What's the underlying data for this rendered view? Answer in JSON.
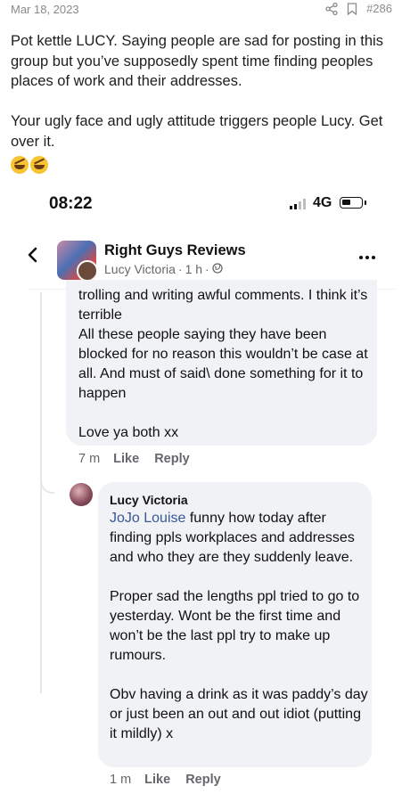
{
  "post": {
    "date": "Mar 18, 2023",
    "number": "#286",
    "body": "Pot kettle LUCY. Saying people are sad for posting in this group but you’ve supposedly spent time finding peoples places of work and their addresses.\n\nYour ugly face and ugly attitude triggers people Lucy. Get over it.",
    "emojis": [
      "rolling-on-floor-laughing",
      "rolling-on-floor-laughing"
    ]
  },
  "phone": {
    "time": "08:22",
    "network": "4G"
  },
  "group": {
    "name": "Right Guys Reviews",
    "author": "Lucy Victoria",
    "age": "1 h",
    "separator": "·"
  },
  "comment1": {
    "text": "trolling and writing awful comments. I think it’s terrible\nAll these people saying they have been blocked for no reason this wouldn’t be case at all. And must of said\\ done something for it to happen\n\nLove ya both xx",
    "time": "7 m",
    "like": "Like",
    "reply": "Reply"
  },
  "comment2": {
    "author": "Lucy Victoria",
    "mention": "JoJo Louise",
    "text": " funny how today after finding ppls workplaces and addresses and who they are they suddenly leave.\n\nProper sad the lengths ppl tried to go to yesterday. Wont be the first time and won’t be the last ppl try to make up rumours.\n\nObv having a drink as it was paddy’s day or just been an out and out idiot (putting it mildly) x",
    "time": "1 m",
    "like": "Like",
    "reply": "Reply"
  },
  "colors": {
    "bubble": "#f0f2f5",
    "mention": "#385898",
    "meta": "#65676b"
  }
}
